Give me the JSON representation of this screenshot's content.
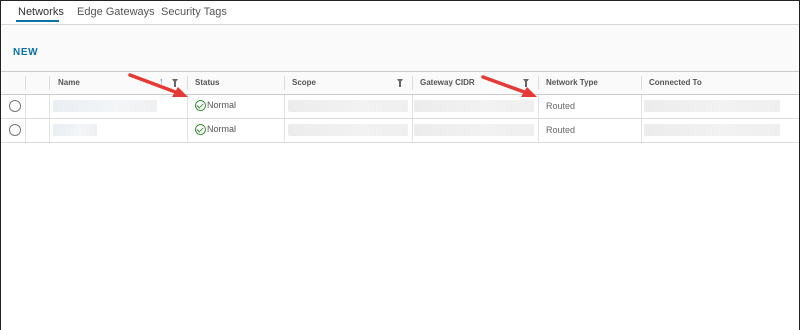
{
  "tabs": [
    {
      "label": "Networks",
      "active": true
    },
    {
      "label": "Edge Gateways",
      "active": false
    },
    {
      "label": "Security Tags",
      "active": false
    }
  ],
  "toolbar": {
    "new_label": "NEW"
  },
  "table": {
    "columns": [
      "Name",
      "Status",
      "Scope",
      "Gateway CIDR",
      "Network Type",
      "Connected To"
    ],
    "rows": [
      {
        "status": "Normal",
        "network_type": "Routed"
      },
      {
        "status": "Normal",
        "network_type": "Routed"
      }
    ]
  },
  "colors": {
    "accent": "#0a72a9",
    "annotation_arrow": "#e53935",
    "status_ok": "#3e8f3e"
  }
}
